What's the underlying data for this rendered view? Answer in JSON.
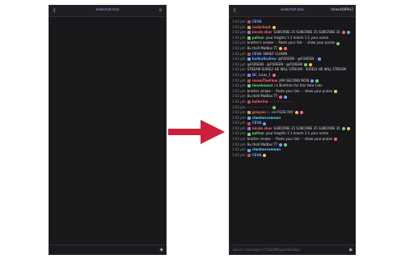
{
  "left": {
    "header_title": "webchat box",
    "settings_icon": "gear-icon",
    "arrow_icon": "back-icon",
    "footer_icon": "stack-icon"
  },
  "right": {
    "header_title": "webchat box",
    "header_right": "lolwut089e2",
    "footer_text": "Send a message in Chat/Whisper/Emotes",
    "footer_icon": "stack-icon",
    "messages": [
      {
        "time": "1:02 pm",
        "badge": "#c24a4a",
        "user": "CEVA",
        "ucolor": "#5ea7ff",
        "text": ""
      },
      {
        "time": "1:02 pm",
        "badge": "#d2a04b",
        "user": "cookcheat",
        "ucolor": "#f06a4e",
        "text": ""
      },
      {
        "time": "1:02 pm",
        "badge": "#a66bd4",
        "user": "nicole shor",
        "ucolor": "#ff5e74",
        "text": "SUBCRIBE 35 SUBCRIBE 35 SUBCRIBE 35"
      },
      {
        "time": "1:02 pm",
        "badge": "#6bd46f",
        "user": "patton",
        "ucolor": "#6bd46f",
        "text": "your heights 1:1 hearts 1:1 your name"
      },
      {
        "time": "1:02 pm",
        "badge": "",
        "user": "",
        "ucolor": "#d8d8de",
        "text": "brother's smoke · · Paste your link · · show your praise"
      },
      {
        "time": "1:02 pm",
        "badge": "",
        "user": "",
        "ucolor": "#d8d8de",
        "text": "Bu thell MatBas TT"
      },
      {
        "time": "1:02 pm",
        "badge": "#c24a4a",
        "user": "CEVA",
        "ucolor": "#5ea7ff",
        "text": "SMAEF CLOWN"
      },
      {
        "time": "1:02 pm",
        "badge": "#5ea7ff",
        "user": "ballkaRodlew",
        "ucolor": "#5ea7ff",
        "text": "@FOREEN · @FOREEN ·"
      },
      {
        "time": "1:02 pm",
        "badge": "",
        "user": "",
        "ucolor": "#d8d8de",
        "text": "@FOREEN · @FOREEN · @FOREEN"
      },
      {
        "time": "1:02 pm",
        "badge": "",
        "user": "",
        "ucolor": "#d8d8de",
        "text": "STREAM SURELY HE WILL STREAM · SURELY HE WILL STREAM"
      },
      {
        "time": "1:02 pm",
        "badge": "#7f7fff",
        "user": "DC",
        "ucolor": "#8b8bff",
        "text": "lucas_1"
      },
      {
        "time": "1:02 pm",
        "badge": "#c24a4a",
        "user": "ravenTheFlow",
        "ucolor": "#ff5e74",
        "text": "JAM SECOND NOW"
      },
      {
        "time": "1:02 pm",
        "badge": "#6bd46f",
        "user": "tweeknessl",
        "ucolor": "#6bd46f",
        "text": "i:n Brethren for this Vote Cats"
      },
      {
        "time": "1:02 pm",
        "badge": "",
        "user": "",
        "ucolor": "#d8d8de",
        "text": "brother smoke · · Paste your link · · show your praise"
      },
      {
        "time": "1:02 pm",
        "badge": "",
        "user": "",
        "ucolor": "#d8d8de",
        "text": "Bu thell MatBas TT"
      },
      {
        "time": "1:02 pm",
        "badge": "#c24a4a",
        "user": "ballerina",
        "ucolor": "#ff5e74",
        "text": "· · · · · · · · · · · ·"
      },
      {
        "time": "1:02 pm",
        "badge": "",
        "user": "",
        "ucolor": "#d8d8de",
        "text": "· · · · · · · · · · · ·"
      },
      {
        "time": "1:02 pm",
        "badge": "#d2a04b",
        "user": "greyum",
        "ucolor": "#f06a4e",
        "text": "i · cel FGOE RAY"
      },
      {
        "time": "1:02 pm",
        "badge": "#5ea7ff",
        "user": "cheshercomeon",
        "ucolor": "#58d3ff",
        "text": ""
      },
      {
        "time": "1:02 pm",
        "badge": "#c24a4a",
        "user": "CEVA",
        "ucolor": "#5ea7ff",
        "text": ""
      },
      {
        "time": "1:02 pm",
        "badge": "#a66bd4",
        "user": "nicole shor",
        "ucolor": "#ff5e74",
        "text": "SUBCRIBE 35 SUBCRIBE 35 SUBCRIBE 35"
      },
      {
        "time": "1:02 pm",
        "badge": "#6bd46f",
        "user": "patton",
        "ucolor": "#6bd46f",
        "text": "your heights 1:1 hearts 1:1 your name"
      },
      {
        "time": "1:02 pm",
        "badge": "",
        "user": "",
        "ucolor": "#d8d8de",
        "text": "brother smoke · · Paste your link · · show your praise"
      },
      {
        "time": "1:02 pm",
        "badge": "",
        "user": "",
        "ucolor": "#d8d8de",
        "text": "Bu thell MatBas TT"
      },
      {
        "time": "1:02 pm",
        "badge": "#5ea7ff",
        "user": "cheshercomeon",
        "ucolor": "#58d3ff",
        "text": ""
      },
      {
        "time": "1:02 pm",
        "badge": "#c24a4a",
        "user": "CEVA",
        "ucolor": "#5ea7ff",
        "text": ""
      }
    ]
  },
  "arrow": {
    "color": "#cc1f3a"
  }
}
